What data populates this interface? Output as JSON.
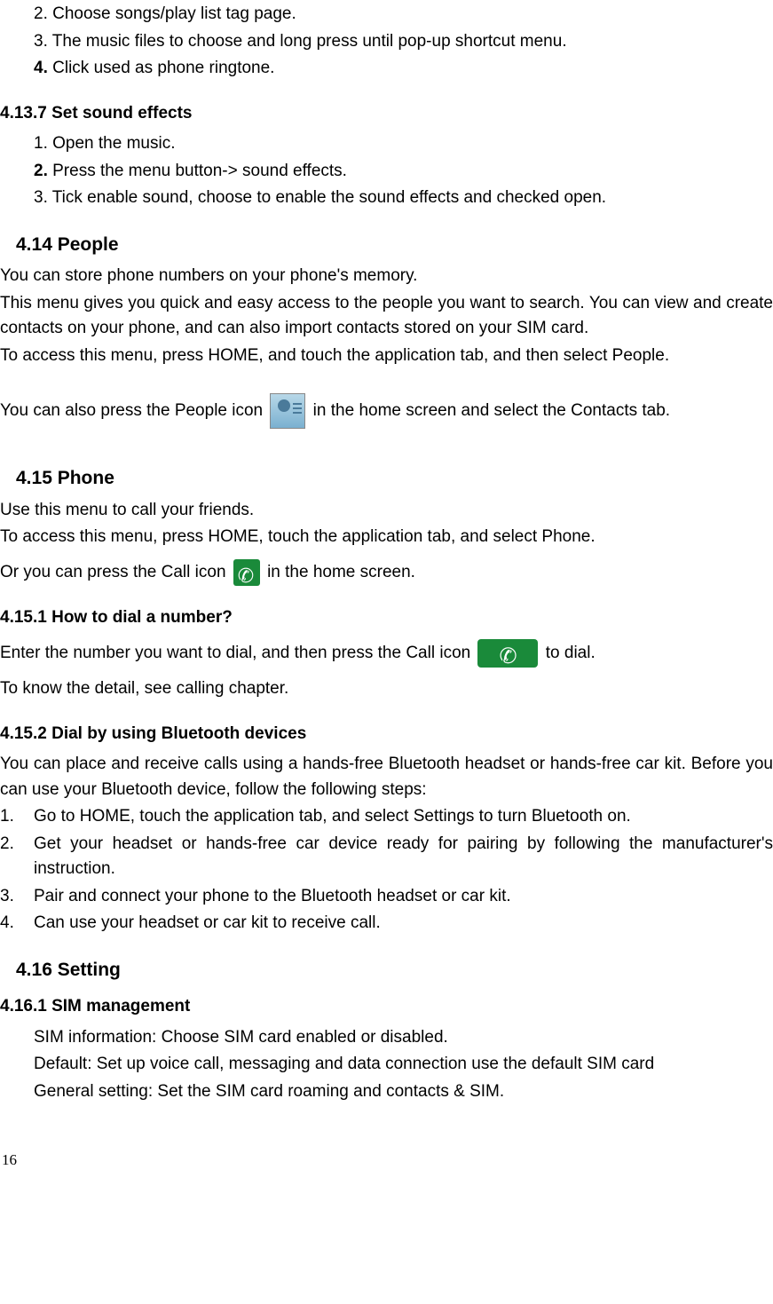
{
  "items": {
    "i1": "2. Choose songs/play list tag page.",
    "i2": "3. The music files to choose and long press until pop-up shortcut menu.",
    "i3_bold": "4.",
    "i3_rest": " Click used as phone ringtone."
  },
  "s4137": {
    "title": "4.13.7  Set sound effects",
    "l1": "1. Open the music.",
    "l2_bold": "2.",
    "l2_rest": " Press the menu button-> sound effects.",
    "l3": "3. Tick enable sound, choose to enable the sound effects and checked open."
  },
  "s414": {
    "title": "4.14  People",
    "p1": "You can store phone numbers on your phone's memory.",
    "p2": "This menu gives you quick and easy access to the people you want to search. You can view and create contacts on your phone, and can also import contacts stored on your SIM card.",
    "p3": "To access this menu, press HOME, and touch the application tab, and then select People.",
    "p4a": "You can also press the People icon ",
    "p4b": " in the home screen and select the Contacts tab."
  },
  "s415": {
    "title": "4.15  Phone",
    "p1": "Use this menu to call your friends.",
    "p2": "To access this menu, press HOME, touch the application tab, and select Phone.",
    "p3a": "Or you can press the Call icon  ",
    "p3b": " in the home screen."
  },
  "s4151": {
    "title": "4.15.1  How to dial a number?",
    "p1a": "Enter the number you want to dial, and then press the Call icon  ",
    "p1b": " to dial.",
    "p2": "To know the detail, see calling chapter."
  },
  "s4152": {
    "title": "4.15.2  Dial by using Bluetooth devices",
    "p1": "You can place and receive calls using a hands-free Bluetooth headset or hands-free car kit. Before you can use your Bluetooth device, follow the following steps:",
    "n1": "1.",
    "t1": "Go to HOME, touch the application tab, and select Settings to turn Bluetooth on.",
    "n2": "2.",
    "t2": "Get your headset or hands-free car device ready for pairing by following the manufacturer's instruction.",
    "n3": "3.",
    "t3": "Pair and connect your phone to the Bluetooth headset or car kit.",
    "n4": "4.",
    "t4": "Can use your headset or car kit to receive call."
  },
  "s416": {
    "title": "4.16  Setting"
  },
  "s4161": {
    "title": "4.16.1  SIM management",
    "l1": "SIM information: Choose SIM card enabled or disabled.",
    "l2": "Default: Set up voice call, messaging and data connection use the default SIM card",
    "l3": "General setting: Set the SIM card roaming and contacts & SIM."
  },
  "page": "16"
}
